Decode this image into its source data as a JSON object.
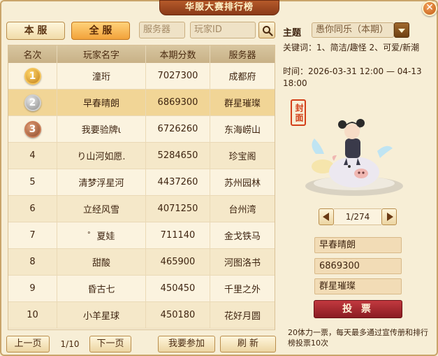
{
  "window": {
    "title": "华服大赛排行榜",
    "close_label": "✕"
  },
  "tabs": [
    {
      "label": "本 服",
      "active": false
    },
    {
      "label": "全 服",
      "active": true
    }
  ],
  "search": {
    "server_placeholder": "服务器",
    "player_placeholder": "玩家ID"
  },
  "table": {
    "headers": {
      "rank": "名次",
      "name": "玩家名字",
      "score": "本期分数",
      "server": "服务器"
    },
    "rows": [
      {
        "rank": "1",
        "name": "潼珩",
        "score": "7027300",
        "server": "成都府",
        "medal": "gold"
      },
      {
        "rank": "2",
        "name": "早春晴朗",
        "score": "6869300",
        "server": "群星璀璨",
        "medal": "silver",
        "selected": true
      },
      {
        "rank": "3",
        "name": "我要验牌ι",
        "score": "6726260",
        "server": "东海崂山",
        "medal": "bronze"
      },
      {
        "rank": "4",
        "name": "り山河如愿.",
        "score": "5284650",
        "server": "珍宝阁"
      },
      {
        "rank": "5",
        "name": "清梦浮星河",
        "score": "4437260",
        "server": "苏州园林"
      },
      {
        "rank": "6",
        "name": "立经风雪",
        "score": "4071250",
        "server": "台州湾"
      },
      {
        "rank": "7",
        "name": "゜夏娃",
        "score": "711140",
        "server": "金戈铁马"
      },
      {
        "rank": "8",
        "name": "甜酸",
        "score": "465900",
        "server": "河图洛书"
      },
      {
        "rank": "9",
        "name": "昏古七",
        "score": "450450",
        "server": "千里之外"
      },
      {
        "rank": "10",
        "name": "小羊星球",
        "score": "450180",
        "server": "花好月圆"
      }
    ]
  },
  "pagination": {
    "prev": "上一页",
    "page": "1/10",
    "next": "下一页"
  },
  "actions": {
    "join": "我要参加",
    "refresh": "刷 新"
  },
  "theme": {
    "label": "主题",
    "value": "愚你同乐（本期）",
    "keywords": "关键词：1、简洁/趣怪 2、可爱/新潮",
    "time": "时间：2026-03-31 12:00 — 04-13 18:00"
  },
  "preview": {
    "seal": "封面",
    "counter": "1/274"
  },
  "selected_entry": {
    "name": "早春晴朗",
    "score": "6869300",
    "server": "群星璀璨"
  },
  "vote_label": "投 票",
  "note": "20体力一票，每天最多通过宣传册和排行榜投票10次",
  "colors": {
    "accent": "#f2a23a",
    "vote": "#a8262c",
    "title_banner": "#9a4420",
    "selected_row": "#f1d596"
  }
}
